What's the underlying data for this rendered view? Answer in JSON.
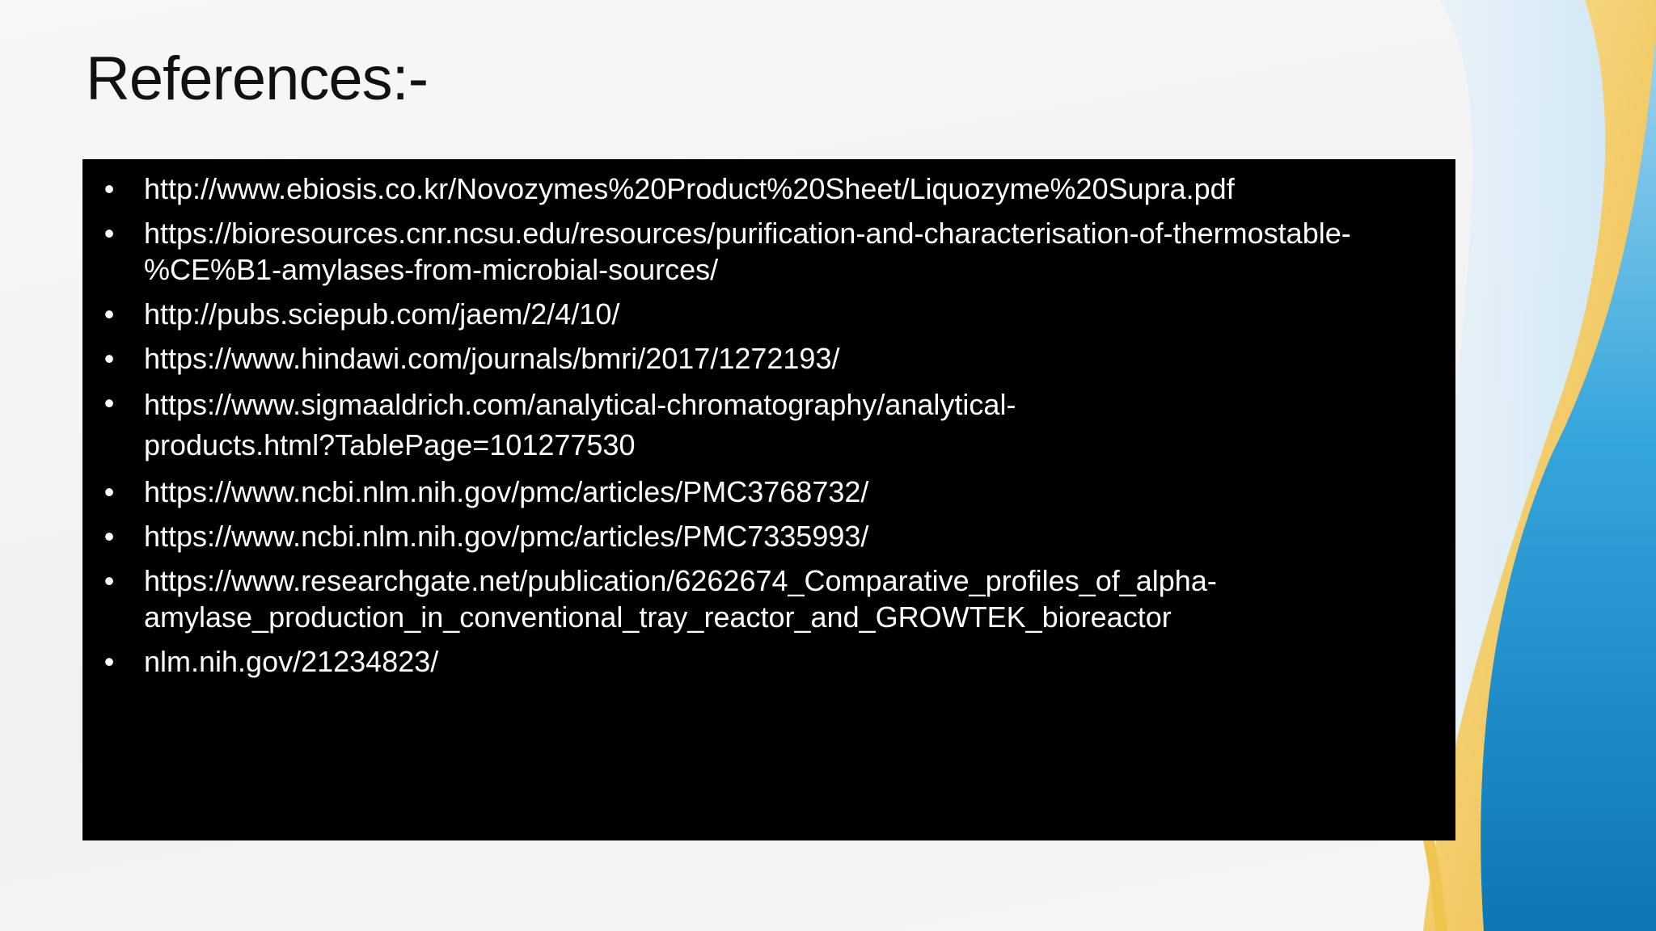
{
  "slide": {
    "title": "References:-"
  },
  "references": [
    {
      "line1": "http://www.ebiosis.co.kr/Novozymes%20Product%20Sheet/Liquozyme%20Supra.pdf",
      "line2": ""
    },
    {
      "line1": "https://bioresources.cnr.ncsu.edu/resources/purification-and-characterisation-of-thermostable-",
      "line2": "%CE%B1-amylases-from-microbial-sources/"
    },
    {
      "line1": "http://pubs.sciepub.com/jaem/2/4/10/",
      "line2": ""
    },
    {
      "line1": "https://www.hindawi.com/journals/bmri/2017/1272193/",
      "line2": ""
    },
    {
      "line1": "https://www.sigmaaldrich.com/analytical-chromatography/analytical-",
      "line2": "products.html?TablePage=101277530"
    },
    {
      "line1": "https://www.ncbi.nlm.nih.gov/pmc/articles/PMC3768732/",
      "line2": ""
    },
    {
      "line1": "https://www.ncbi.nlm.nih.gov/pmc/articles/PMC7335993/",
      "line2": ""
    },
    {
      "line1": "https://www.researchgate.net/publication/6262674_Comparative_profiles_of_alpha-",
      "line2": "amylase_production_in_conventional_tray_reactor_and_GROWTEK_bioreactor"
    },
    {
      "line1": "nlm.nih.gov/21234823/",
      "line2": ""
    }
  ],
  "bullet_char": "•",
  "colors": {
    "background": "#f5f5f5",
    "box": "#000000",
    "text": "#ffffff",
    "title": "#111111",
    "wave_gold": "#f2c75c",
    "wave_blue": "#1f8fc9",
    "wave_light_blue": "#bfe0f2"
  }
}
